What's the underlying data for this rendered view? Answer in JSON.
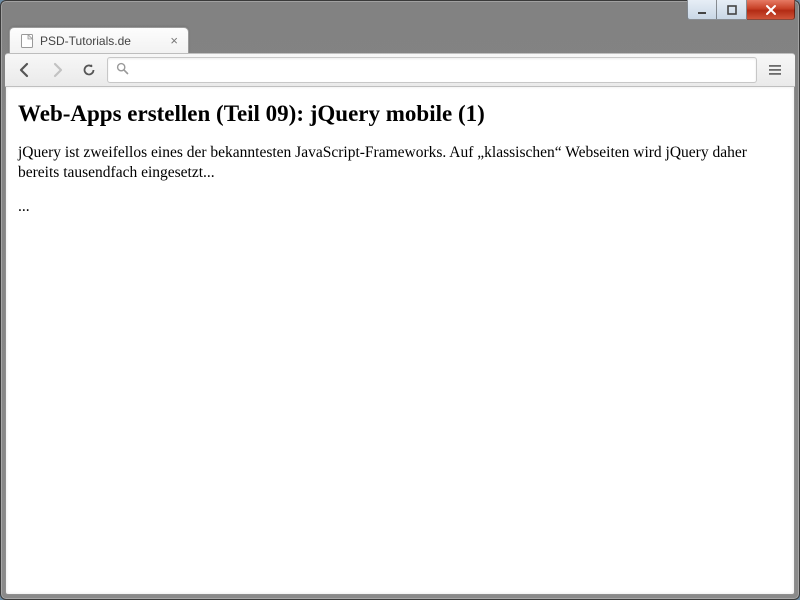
{
  "window": {
    "tab_title": "PSD-Tutorials.de"
  },
  "omnibox": {
    "value": "",
    "placeholder": ""
  },
  "page": {
    "heading": "Web-Apps erstellen (Teil 09): jQuery mobile (1)",
    "paragraph": "jQuery ist zweifellos eines der bekanntesten JavaScript-Frameworks. Auf „klassischen“ Webseiten wird jQuery daher bereits tausendfach eingesetzt...",
    "ellipsis": "..."
  }
}
